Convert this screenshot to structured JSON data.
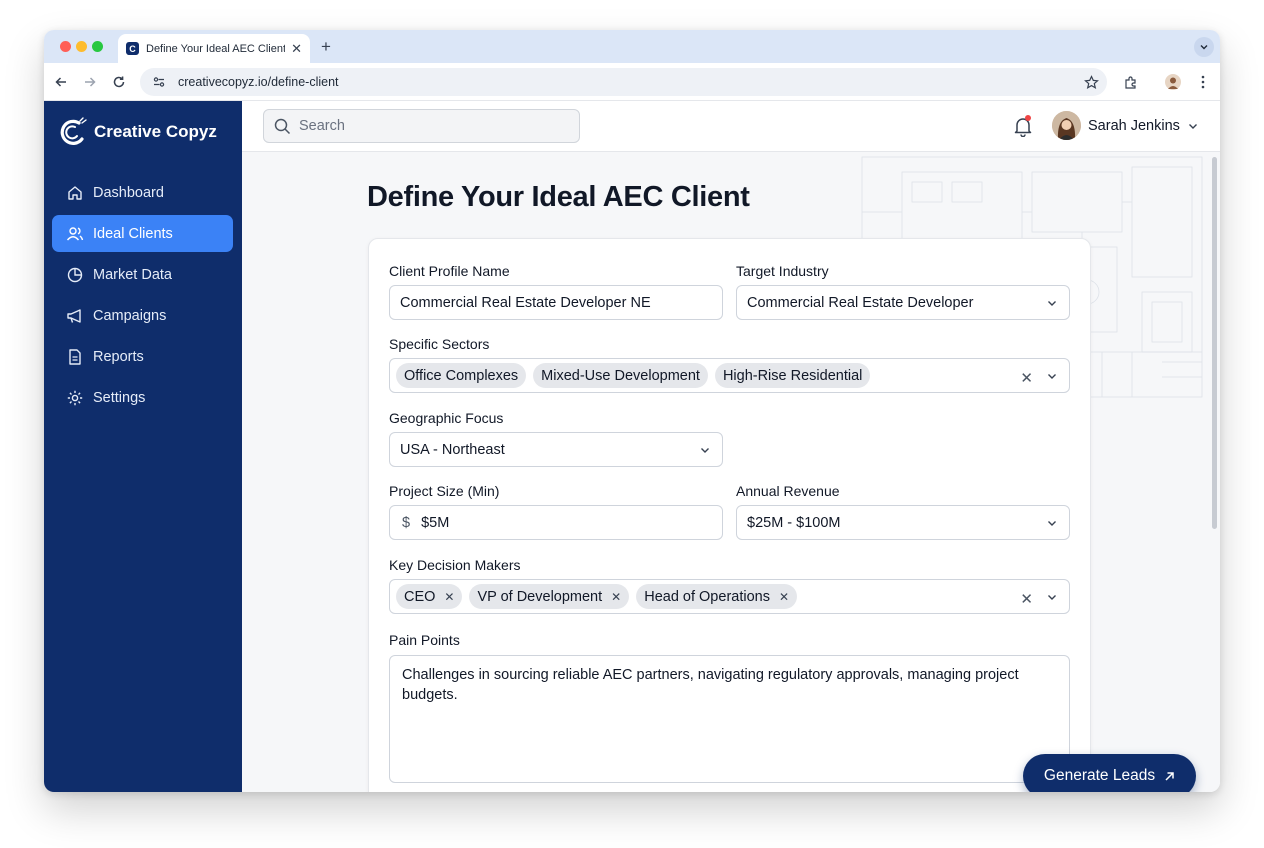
{
  "browser": {
    "tab_title": "Define Your Ideal AEC Client",
    "tab_favicon_letter": "C",
    "url": "creativecopyz.io/define-client"
  },
  "sidebar": {
    "brand": "Creative Copyz",
    "items": [
      {
        "label": "Dashboard",
        "icon": "home-icon",
        "active": false
      },
      {
        "label": "Ideal Clients",
        "icon": "users-icon",
        "active": true
      },
      {
        "label": "Market Data",
        "icon": "pie-chart-icon",
        "active": false
      },
      {
        "label": "Campaigns",
        "icon": "megaphone-icon",
        "active": false
      },
      {
        "label": "Reports",
        "icon": "document-icon",
        "active": false
      },
      {
        "label": "Settings",
        "icon": "gear-icon",
        "active": false
      }
    ]
  },
  "header": {
    "search_placeholder": "Search",
    "user_name": "Sarah Jenkins",
    "has_notification": true
  },
  "page": {
    "title": "Define Your Ideal AEC Client"
  },
  "form": {
    "profile_name": {
      "label": "Client Profile Name",
      "value": "Commercial Real Estate Developer NE"
    },
    "target_industry": {
      "label": "Target Industry",
      "value": "Commercial Real Estate Developer"
    },
    "sectors": {
      "label": "Specific Sectors",
      "chips": [
        "Office Complexes",
        "Mixed-Use Development",
        "High-Rise Residential"
      ]
    },
    "geo": {
      "label": "Geographic Focus",
      "value": "USA - Northeast"
    },
    "project_size": {
      "label": "Project Size (Min)",
      "currency": "$",
      "value": "$5M"
    },
    "revenue": {
      "label": "Annual Revenue",
      "value": "$25M - $100M"
    },
    "decision_makers": {
      "label": "Key Decision Makers",
      "chips": [
        "CEO",
        "VP of Development",
        "Head of Operations"
      ]
    },
    "pain_points": {
      "label": "Pain Points",
      "value": "Challenges in sourcing reliable AEC partners, navigating regulatory approvals, managing project budgets."
    }
  },
  "actions": {
    "generate_label": "Generate Leads"
  },
  "colors": {
    "sidebar_bg": "#0f2d6b",
    "active_nav": "#3b82f6",
    "cta_bg": "#0f2d6b"
  }
}
